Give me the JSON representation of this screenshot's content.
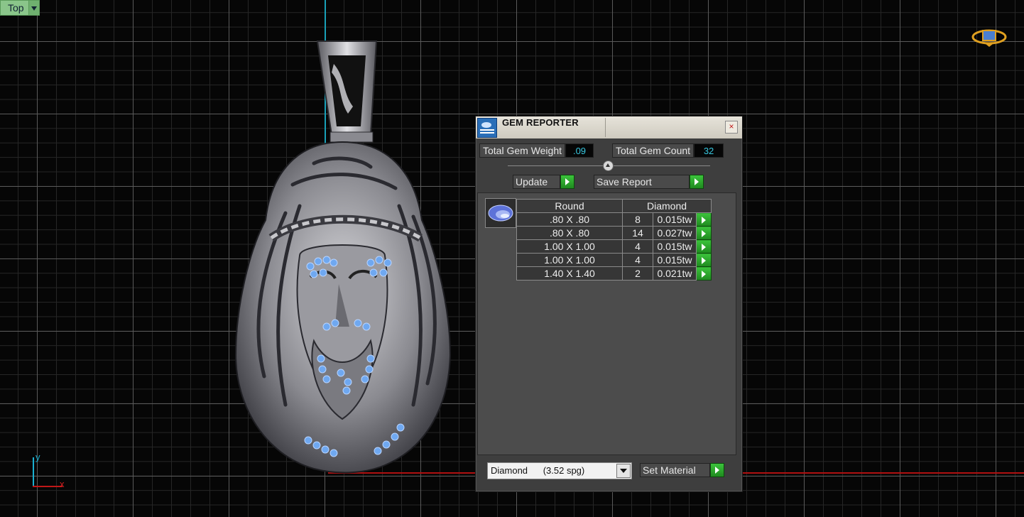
{
  "viewport": {
    "view_name": "Top"
  },
  "axes": {
    "y": "y",
    "x": "x"
  },
  "gem_reporter": {
    "title": "GEM REPORTER",
    "close_symbol": "×",
    "total_weight_label": "Total Gem Weight",
    "total_weight_value": ".09",
    "total_count_label": "Total Gem Count",
    "total_count_value": "32",
    "update_label": "Update",
    "save_report_label": "Save Report",
    "table": {
      "headers": [
        "Round",
        "Diamond"
      ],
      "rows": [
        {
          "size": ".80 X .80",
          "count": "8",
          "weight": "0.015tw"
        },
        {
          "size": ".80 X .80",
          "count": "14",
          "weight": "0.027tw"
        },
        {
          "size": "1.00 X 1.00",
          "count": "4",
          "weight": "0.015tw"
        },
        {
          "size": "1.00 X 1.00",
          "count": "4",
          "weight": "0.015tw"
        },
        {
          "size": "1.40 X 1.40",
          "count": "2",
          "weight": "0.021tw"
        }
      ]
    },
    "material_select": "Diamond      (3.52 spg)",
    "set_material_label": "Set Material"
  },
  "colors": {
    "stone": "#6fa8f0",
    "metal": "#b8b8bc",
    "go_button": "#2aa82a"
  }
}
